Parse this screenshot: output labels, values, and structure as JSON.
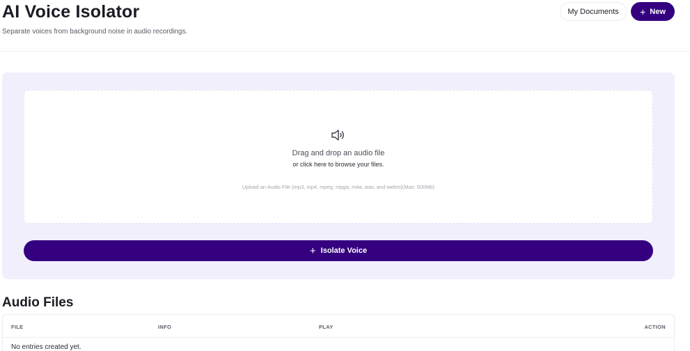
{
  "header": {
    "title": "AI Voice Isolator",
    "subtitle": "Separate voices from background noise in audio recordings.",
    "my_documents_label": "My Documents",
    "new_label": "New",
    "new_icon": "plus-icon"
  },
  "upload": {
    "icon": "speaker-icon",
    "title": "Drag and drop an audio file",
    "subtitle": "or click here to browse your files.",
    "hint": "Upload an Audio File (mp3, mp4, mpeg, mpga, m4a, wav, and webm)(Max: 500Mb)"
  },
  "action": {
    "isolate_label": "Isolate Voice",
    "isolate_icon": "plus-icon"
  },
  "files": {
    "title": "Audio Files",
    "columns": [
      "FILE",
      "INFO",
      "PLAY",
      "ACTION"
    ],
    "empty_message": "No entries created yet."
  },
  "colors": {
    "accent": "#350080",
    "panel_bg": "#f1effc",
    "border": "#ececf2"
  }
}
